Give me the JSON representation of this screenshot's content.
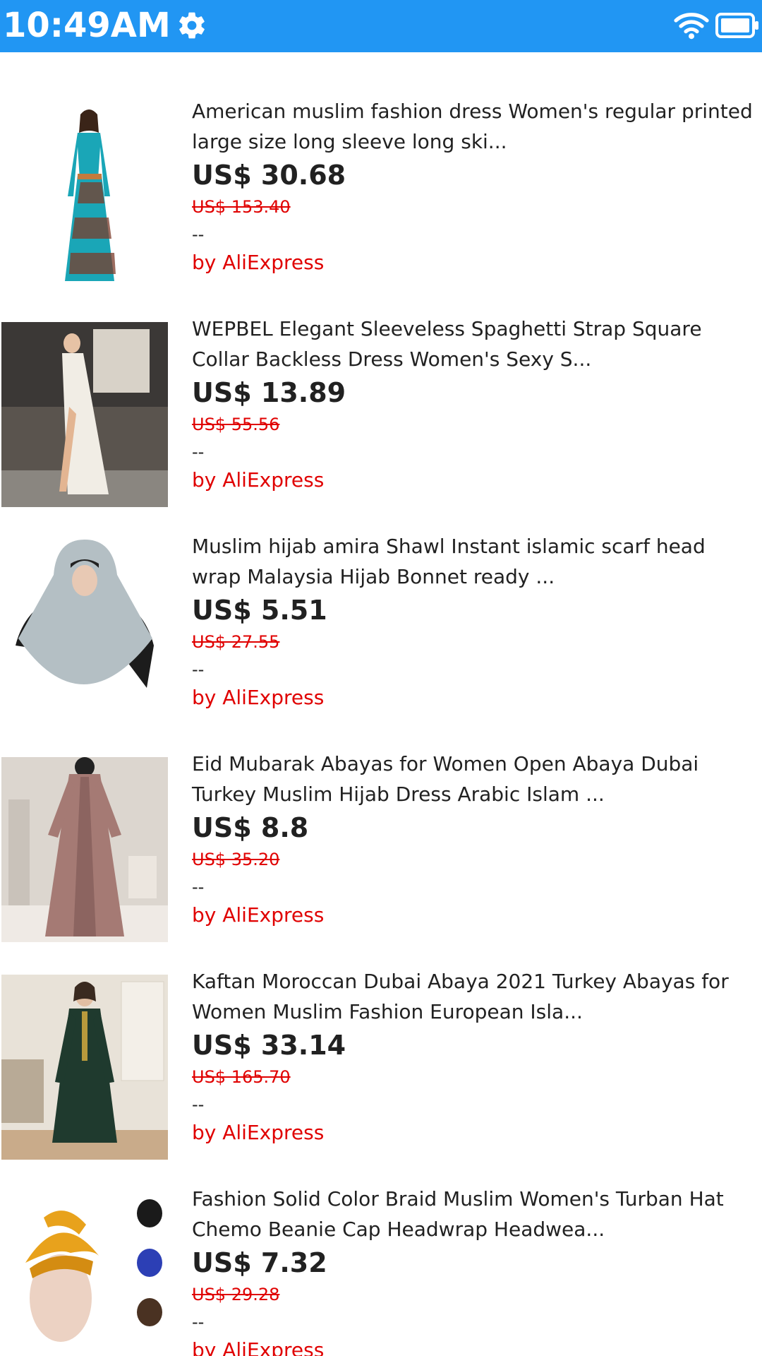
{
  "status_bar": {
    "time": "10:49AM",
    "background": "#2196f3",
    "icons": [
      "gear-icon",
      "wifi-icon",
      "battery-icon"
    ]
  },
  "products": [
    {
      "title": "American muslim fashion dress Women's regular printed large size long sleeve long ski...",
      "price": "US$ 30.68",
      "original_price": "US$ 153.40",
      "extra": "--",
      "seller": "by AliExpress"
    },
    {
      "title": "WEPBEL Elegant Sleeveless Spaghetti Strap Square Collar Backless Dress Women's Sexy S...",
      "price": "US$ 13.89",
      "original_price": "US$ 55.56",
      "extra": "--",
      "seller": "by AliExpress"
    },
    {
      "title": "Muslim hijab amira Shawl Instant islamic scarf head wrap Malaysia Hijab Bonnet ready ...",
      "price": "US$ 5.51",
      "original_price": "US$ 27.55",
      "extra": "--",
      "seller": "by AliExpress"
    },
    {
      "title": "Eid Mubarak Abayas for Women Open Abaya Dubai Turkey Muslim Hijab Dress Arabic Islam ...",
      "price": "US$ 8.8",
      "original_price": "US$ 35.20",
      "extra": "--",
      "seller": "by AliExpress"
    },
    {
      "title": "Kaftan Moroccan Dubai Abaya 2021 Turkey Abayas for Women Muslim Fashion European Isla...",
      "price": "US$ 33.14",
      "original_price": "US$ 165.70",
      "extra": "--",
      "seller": "by AliExpress"
    },
    {
      "title": "Fashion Solid Color Braid Muslim Women's Turban Hat Chemo Beanie Cap Headwrap Headwea...",
      "price": "US$ 7.32",
      "original_price": "US$ 29.28",
      "extra": "--",
      "seller": "by AliExpress"
    }
  ],
  "colors": {
    "accent": "#2196f3",
    "sale_red": "#e00000",
    "text": "#212121"
  }
}
